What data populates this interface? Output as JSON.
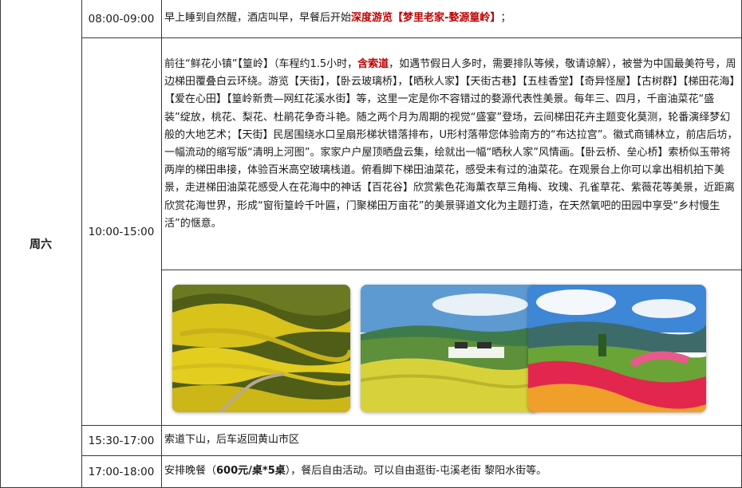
{
  "day": "周六",
  "rows": [
    {
      "time": "08:00-09:00",
      "segments": [
        {
          "text": "早上睡到自然醒，酒店叫早，早餐后开始",
          "style": "normal"
        },
        {
          "text": "深度游览【梦里老家-婺源篁岭】",
          "style": "red-bold"
        },
        {
          "text": "；",
          "style": "normal"
        }
      ]
    },
    {
      "time": "10:00-15:00",
      "segments": [
        {
          "text": "前往“鲜花小镇”【篁岭】（车程约1.5小时，",
          "style": "normal"
        },
        {
          "text": "含索道",
          "style": "red-bold"
        },
        {
          "text": "，如遇节假日人多时，需要排队等候，敬请谅解），被誉为中国最美符号，周边梯田覆叠白云环绕。游览【天街】，【卧云玻璃桥】，【晒秋人家】【天街古巷】【五桂香堂】【奇异怪屋】【古树群】【梯田花海】【爱在心田】【篁岭新贵—网红花溪水街】等，这里一定是你不容错过的婺源代表性美景。每年三、四月，千亩油菜花“盛装”绽放，桃花、梨花、杜鹃花争奇斗艳。随之两个月为周期的视觉“盛宴”登场，云间梯田花卉主题变化莫测，轮番演绎梦幻般的大地艺术；【天街】民居围绕水口呈扇形梯状错落排布，U形村落带您体验南方的“布达拉宫”。徽式商铺林立，前店后坊，一幅流动的缩写版“清明上河图”。家家户户屋顶晒盘云集，绘就出一幅“晒秋人家”风情画。【卧云桥、垒心桥】索桥似玉带将两岸的梯田串接，体验百米高空玻璃栈道。俯看脚下梯田油菜花，感受未有过的油菜花。在观景台上你可以拿出相机拍下美景，走进梯田油菜花感受人在花海中的神话【百花谷】欣赏紫色花海薰衣草三角梅、玫瑰、孔雀草花、紫薇花等美景，近距离欣赏花海世界，形成“窗衔篁岭千叶匾，门聚梯田万亩花”的美景驿道文化为主题打造，在天然氧吧的田园中享受“乡村慢生活”的惬意。",
          "style": "normal"
        }
      ]
    },
    {
      "time": "15:30-17:00",
      "segments": [
        {
          "text": "索道下山，后车返回黄山市区",
          "style": "normal"
        }
      ]
    },
    {
      "time": "17:00-18:00",
      "segments": [
        {
          "text": "安排晚餐（",
          "style": "normal"
        },
        {
          "text": "600元/桌*5桌",
          "style": "bold"
        },
        {
          "text": "），餐后自由活动。可以自由逛街-屯溪老街 黎阳水街等。",
          "style": "normal"
        }
      ]
    }
  ],
  "photos": [
    {
      "name": "terraced-rapeseed-fields-photo",
      "palette": {
        "field": "#d9c21a",
        "terrace": "#5b6b1c",
        "path": "#b9a98c"
      }
    },
    {
      "name": "valley-village-photo",
      "palette": {
        "sky": "#5d9ad2",
        "mountain": "#3f7a4b",
        "field": "#d8d23a",
        "village": "#f2f2ee"
      }
    },
    {
      "name": "flower-hillside-photo",
      "palette": {
        "sky": "#3e86d6",
        "mountain": "#3d6b6a",
        "flowers": "#e2264e",
        "grass": "#6aa436"
      }
    }
  ]
}
